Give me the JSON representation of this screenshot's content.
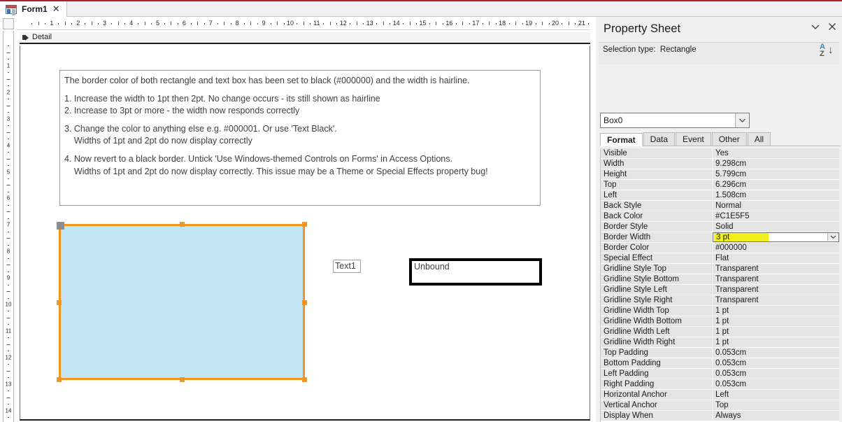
{
  "window": {
    "tab": {
      "label": "Form1",
      "icon": "form-icon",
      "close": "✕"
    },
    "accent_color": "#a4262c"
  },
  "rulers": {
    "horizontal_max": 31,
    "vertical_max": 14
  },
  "design": {
    "section_label": "Detail",
    "note": {
      "lines": [
        "The border color of both rectangle and text box has been set to black (#000000) and the width is hairline.",
        "",
        "1. Increase the width to 1pt then 2pt. No change occurs - its still shown as hairline",
        "2. Increase to 3pt or more - the width now responds correctly",
        "",
        "3. Change the color to anything else e.g. #000001. Or use 'Text Black'.",
        "    Widths of 1pt and 2pt do now display correctly",
        "",
        "4. Now revert to a black border. Untick 'Use Windows-themed Controls on Forms' in Access Options.",
        "    Widths of 1pt and 2pt do now display correctly. This issue may be a Theme or Special Effects property bug!"
      ]
    },
    "rectangle": {
      "fill_color": "#C1E5F5",
      "border_color": "#000000",
      "selection_color": "#F7941E"
    },
    "label": {
      "text": "Text1"
    },
    "textbox": {
      "text": "Unbound"
    }
  },
  "property_sheet": {
    "title": "Property Sheet",
    "collapse_icon": "chevron-down-icon",
    "close_icon": "close-icon",
    "selection_type_label": "Selection type:",
    "selection_type_value": "Rectangle",
    "sort_button": {
      "a": "A",
      "z": "Z",
      "arrow": "↓"
    },
    "object_combo": {
      "value": "Box0",
      "chevron": "chevron-down-icon"
    },
    "tabs": [
      {
        "label": "Format",
        "active": true
      },
      {
        "label": "Data",
        "active": false
      },
      {
        "label": "Event",
        "active": false
      },
      {
        "label": "Other",
        "active": false
      },
      {
        "label": "All",
        "active": false
      }
    ],
    "highlight_color": "#F2EF1C",
    "properties": [
      {
        "name": "Visible",
        "value": "Yes"
      },
      {
        "name": "Width",
        "value": "9.298cm"
      },
      {
        "name": "Height",
        "value": "5.799cm"
      },
      {
        "name": "Top",
        "value": "6.296cm"
      },
      {
        "name": "Left",
        "value": "1.508cm"
      },
      {
        "name": "Back Style",
        "value": "Normal"
      },
      {
        "name": "Back Color",
        "value": "#C1E5F5"
      },
      {
        "name": "Border Style",
        "value": "Solid"
      },
      {
        "name": "Border Width",
        "value": "3 pt",
        "selected": true,
        "highlighted": true,
        "dropdown": true
      },
      {
        "name": "Border Color",
        "value": "#000000"
      },
      {
        "name": "Special Effect",
        "value": "Flat"
      },
      {
        "name": "Gridline Style Top",
        "value": "Transparent"
      },
      {
        "name": "Gridline Style Bottom",
        "value": "Transparent"
      },
      {
        "name": "Gridline Style Left",
        "value": "Transparent"
      },
      {
        "name": "Gridline Style Right",
        "value": "Transparent"
      },
      {
        "name": "Gridline Width Top",
        "value": "1 pt"
      },
      {
        "name": "Gridline Width Bottom",
        "value": "1 pt"
      },
      {
        "name": "Gridline Width Left",
        "value": "1 pt"
      },
      {
        "name": "Gridline Width Right",
        "value": "1 pt"
      },
      {
        "name": "Top Padding",
        "value": "0.053cm"
      },
      {
        "name": "Bottom Padding",
        "value": "0.053cm"
      },
      {
        "name": "Left Padding",
        "value": "0.053cm"
      },
      {
        "name": "Right Padding",
        "value": "0.053cm"
      },
      {
        "name": "Horizontal Anchor",
        "value": "Left"
      },
      {
        "name": "Vertical Anchor",
        "value": "Top"
      },
      {
        "name": "Display When",
        "value": "Always"
      }
    ]
  }
}
